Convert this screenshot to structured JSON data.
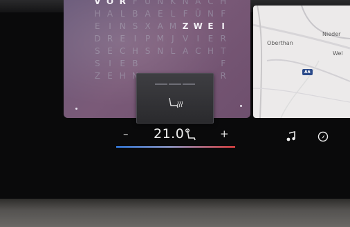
{
  "word_clock": {
    "rows": [
      [
        "V",
        "O",
        "R",
        "F",
        "Ü",
        "N",
        "K",
        "N",
        "A",
        "C",
        "H"
      ],
      [
        "H",
        "A",
        "L",
        "B",
        "A",
        "E",
        "L",
        "F",
        "Ü",
        "N",
        "F"
      ],
      [
        "E",
        "I",
        "N",
        "S",
        "X",
        "A",
        "M",
        "Z",
        "W",
        "E",
        "I"
      ],
      [
        "D",
        "R",
        "E",
        "I",
        "P",
        "M",
        "J",
        "V",
        "I",
        "E",
        "R"
      ],
      [
        "S",
        "E",
        "C",
        "H",
        "S",
        "N",
        "L",
        "A",
        "C",
        "H",
        "T"
      ],
      [
        "S",
        "I",
        "E",
        "B",
        "",
        "",
        "",
        "",
        "",
        "",
        "F"
      ],
      [
        "Z",
        "E",
        "H",
        "N",
        "",
        "",
        "",
        "",
        "",
        "",
        "R"
      ]
    ],
    "lit_words": [
      "VOR",
      "ZWEI"
    ]
  },
  "map": {
    "labels": {
      "town_1": "Oberthan",
      "town_2": "Nieder",
      "town_3": "Wel"
    },
    "road_badge": "A6"
  },
  "seat_heating_popup": {
    "level_bars": 3,
    "icon": "seat-heating-icon"
  },
  "climate": {
    "minus_label": "–",
    "plus_label": "+",
    "temperature": "21.0°",
    "seat_icon": "seat-icon"
  },
  "side_icons": [
    "music-note-icon",
    "navigation-icon"
  ],
  "colors": {
    "cold": "#3a8cff",
    "hot": "#ff4a4a",
    "clock_bg": "#6e4f6d"
  }
}
